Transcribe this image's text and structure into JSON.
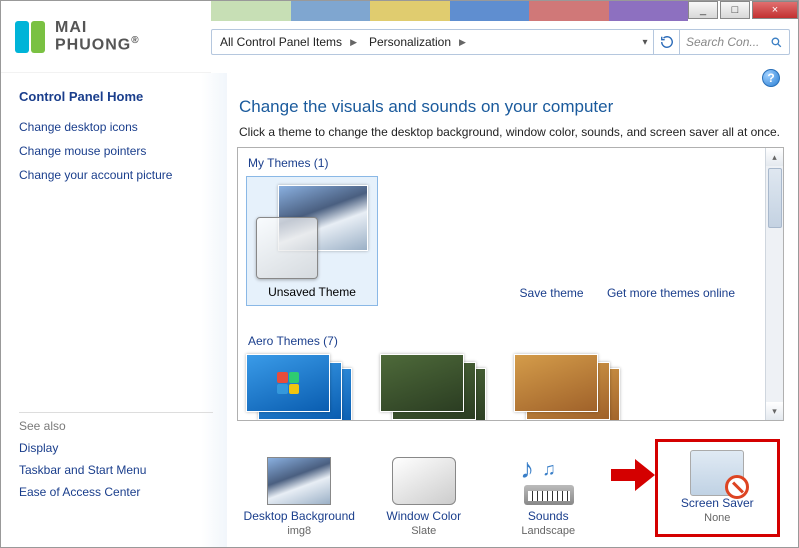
{
  "window": {
    "min_label": "_",
    "max_label": "□",
    "close_label": "×"
  },
  "logo": {
    "line1": "MAI",
    "line2": "PHUONG",
    "reg": "®"
  },
  "breadcrumb": {
    "item1": "All Control Panel Items",
    "item2": "Personalization"
  },
  "search": {
    "placeholder": "Search Con..."
  },
  "sidebar": {
    "home": "Control Panel Home",
    "links": {
      "l1": "Change desktop icons",
      "l2": "Change mouse pointers",
      "l3": "Change your account picture"
    },
    "seealso_hdr": "See also",
    "seealso": {
      "s1": "Display",
      "s2": "Taskbar and Start Menu",
      "s3": "Ease of Access Center"
    }
  },
  "main": {
    "help": "?",
    "title": "Change the visuals and sounds on your computer",
    "subtitle": "Click a theme to change the desktop background, window color, sounds, and screen saver all at once.",
    "my_themes_label": "My Themes (1)",
    "unsaved_theme": "Unsaved Theme",
    "links": {
      "save": "Save theme",
      "more": "Get more themes online"
    },
    "aero_label": "Aero Themes (7)"
  },
  "bottom": {
    "b1": {
      "label": "Desktop Background",
      "value": "img8"
    },
    "b2": {
      "label": "Window Color",
      "value": "Slate"
    },
    "b3": {
      "label": "Sounds",
      "value": "Landscape"
    },
    "b4": {
      "label": "Screen Saver",
      "value": "None"
    }
  }
}
